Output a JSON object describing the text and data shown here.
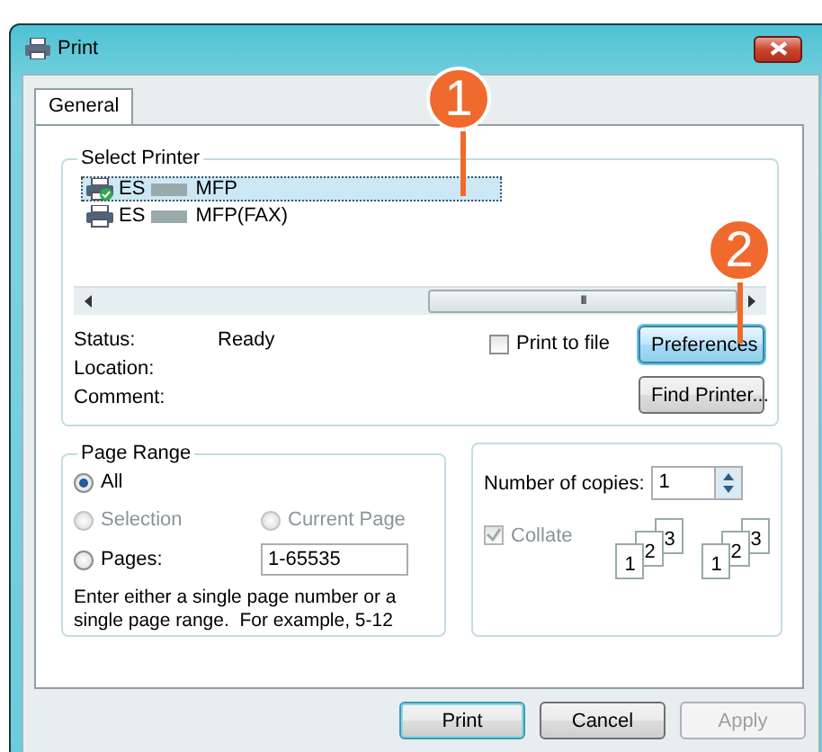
{
  "window": {
    "title": "Print"
  },
  "tabs": [
    {
      "label": "General",
      "selected": true
    }
  ],
  "select_printer": {
    "label": "Select Printer",
    "printers": [
      {
        "text_before": "ES",
        "text_after": "MFP",
        "selected": true,
        "default": true
      },
      {
        "text_before": "ES",
        "text_after": "MFP(FAX)",
        "selected": false,
        "default": false
      }
    ],
    "scroll_grip": "III",
    "info": [
      {
        "label": "Status:",
        "value": "Ready"
      },
      {
        "label": "Location:"
      },
      {
        "label": "Comment:"
      }
    ],
    "print_to_file": {
      "label": "Print to file",
      "checked": false
    },
    "preferences_button": {
      "label": "Preferences",
      "highlighted": true
    },
    "find_printer_button": {
      "label": "Find Printer...",
      "highlighted": false
    }
  },
  "page_range": {
    "label": "Page Range",
    "options": [
      {
        "label": "All",
        "selected": true,
        "disabled": false
      },
      {
        "label": "Selection",
        "selected": false,
        "disabled": true
      },
      {
        "label": "Current Page",
        "selected": false,
        "disabled": true
      },
      {
        "label": "Pages:",
        "selected": false,
        "disabled": false
      }
    ],
    "pages_value": "1-65535",
    "hint": "Enter either a single page number or a single page range.  For example, 5-12"
  },
  "copies": {
    "label": "Number of copies:",
    "value": "1",
    "collate": {
      "label": "Collate",
      "checked": true,
      "disabled": true
    },
    "collate_sets": [
      [
        "1",
        "2",
        "3"
      ],
      [
        "1",
        "2",
        "3"
      ]
    ]
  },
  "buttons": [
    {
      "label": "Print",
      "default": true,
      "disabled": false
    },
    {
      "label": "Cancel",
      "default": false,
      "disabled": false
    },
    {
      "label": "Apply",
      "default": false,
      "disabled": true
    }
  ],
  "callouts": [
    {
      "number": "1"
    },
    {
      "number": "2"
    }
  ]
}
